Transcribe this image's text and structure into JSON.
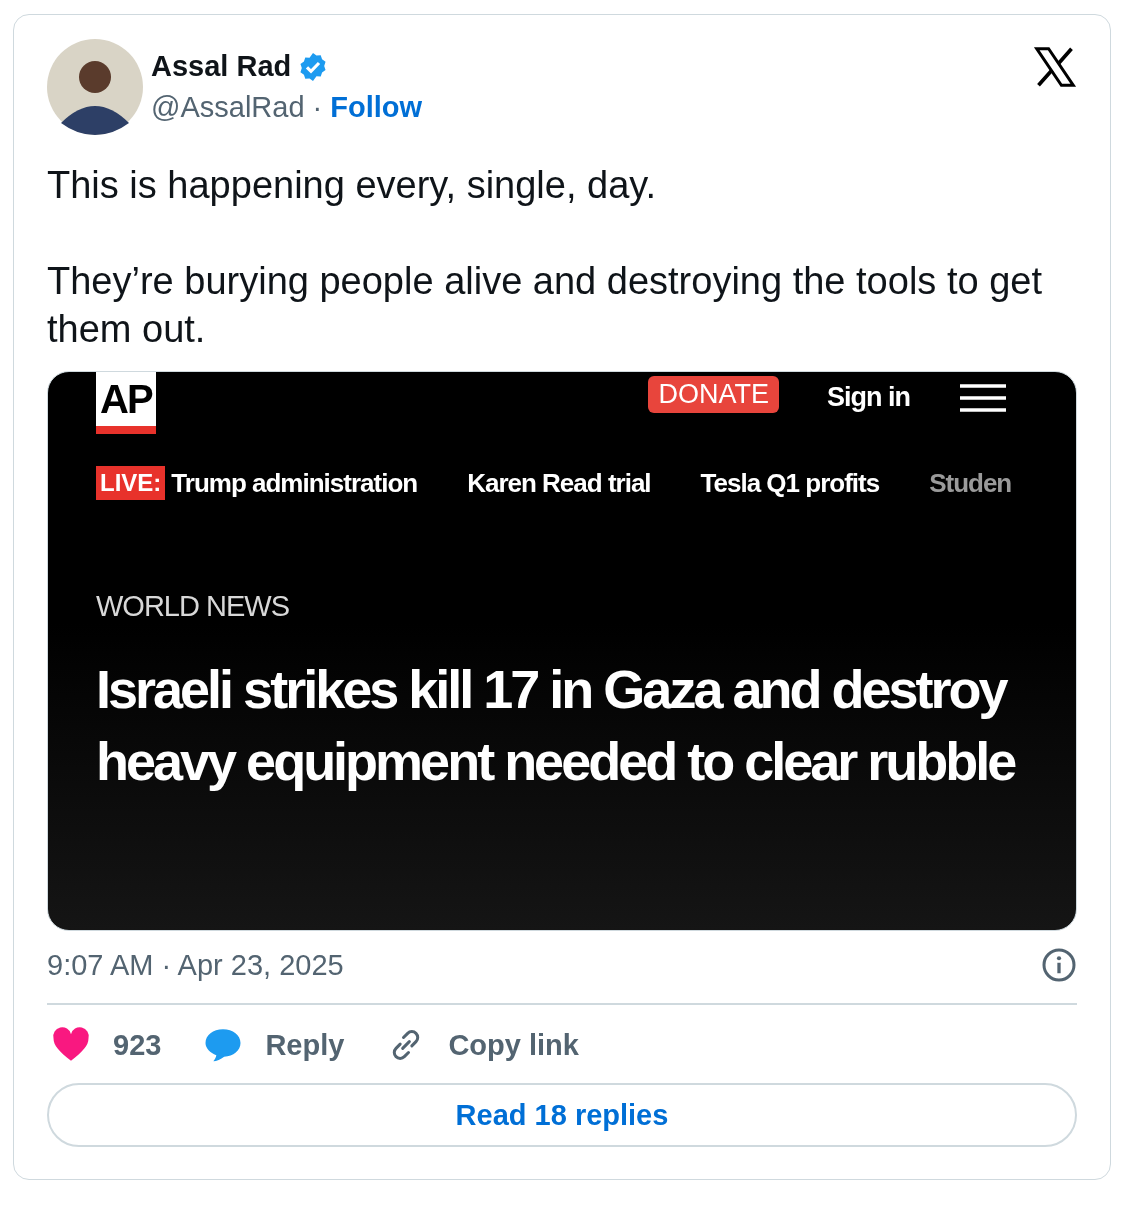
{
  "author": {
    "name": "Assal Rad",
    "verified": true,
    "handle": "@AssalRad",
    "separator": "·",
    "follow": "Follow"
  },
  "text": [
    "This is happening every, single, day.",
    "They’re burying people alive and destroying the tools to get them out."
  ],
  "embed": {
    "logo": "AP",
    "donate": "DONATE",
    "sign_in": "Sign in",
    "nav_items": [
      {
        "badge": "LIVE:",
        "label": "Trump administration",
        "faded": false
      },
      {
        "label": "Karen Read trial",
        "faded": false
      },
      {
        "label": "Tesla Q1 profits",
        "faded": false
      },
      {
        "label": "Studen",
        "faded": true
      }
    ],
    "section": "WORLD NEWS",
    "headline": "Israeli strikes kill 17 in Gaza and destroy heavy equipment needed to clear rubble"
  },
  "timestamp": "9:07 AM · Apr 23, 2025",
  "actions": [
    {
      "kind": "like",
      "label": "923"
    },
    {
      "kind": "reply",
      "label": "Reply"
    },
    {
      "kind": "copy",
      "label": "Copy link"
    }
  ],
  "read_replies": "Read 18 replies"
}
